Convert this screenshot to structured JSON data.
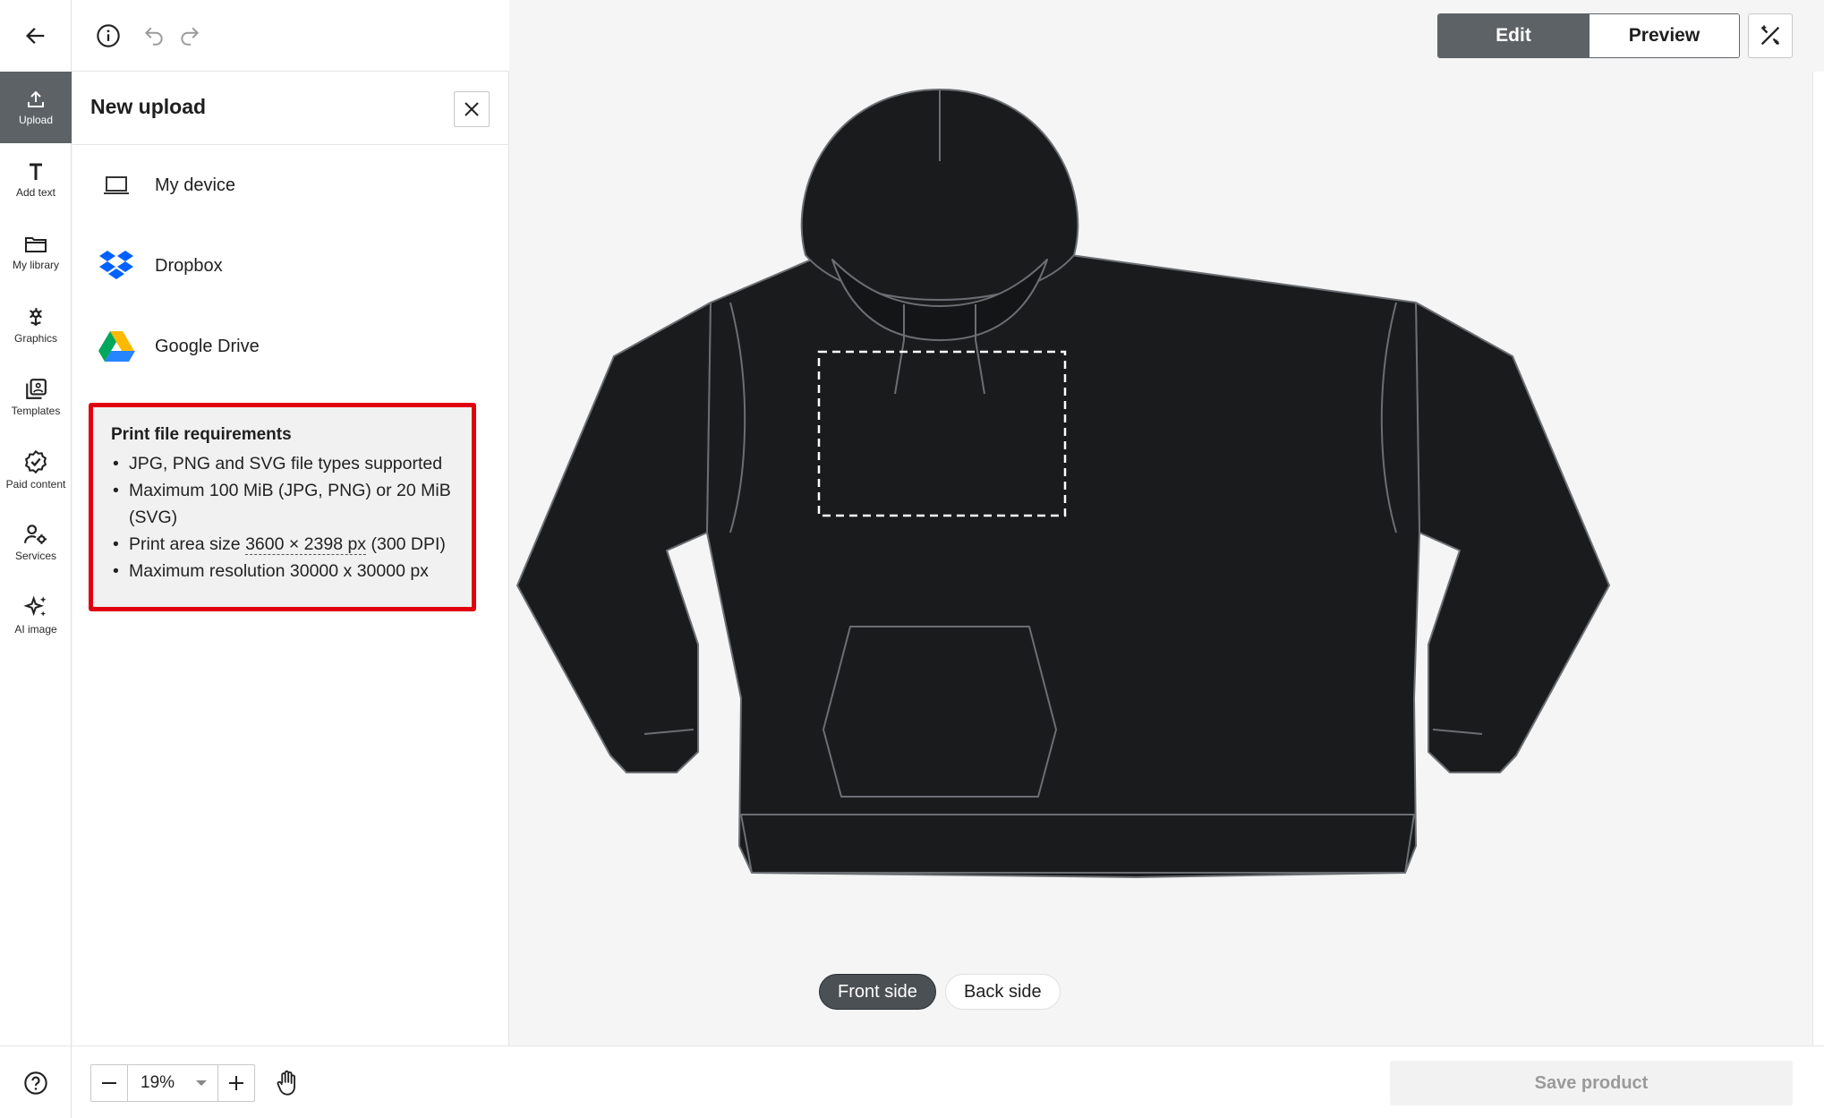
{
  "topbar": {
    "back_icon": "arrow-left-icon",
    "info_icon": "info-icon",
    "undo_icon": "undo-icon",
    "redo_icon": "redo-icon",
    "edit_label": "Edit",
    "preview_label": "Preview",
    "magic_icon": "magic-wand-icon"
  },
  "rail": {
    "items": [
      {
        "label": "Upload",
        "icon": "upload-icon",
        "active": true
      },
      {
        "label": "Add text",
        "icon": "text-icon"
      },
      {
        "label": "My library",
        "icon": "folder-icon"
      },
      {
        "label": "Graphics",
        "icon": "flower-icon"
      },
      {
        "label": "Templates",
        "icon": "template-icon"
      },
      {
        "label": "Paid content",
        "icon": "badge-check-icon"
      },
      {
        "label": "Services",
        "icon": "services-icon"
      },
      {
        "label": "AI image",
        "icon": "sparkle-icon"
      }
    ]
  },
  "panel": {
    "title": "New upload",
    "sources": [
      {
        "label": "My device",
        "icon": "laptop-icon"
      },
      {
        "label": "Dropbox",
        "icon": "dropbox-icon"
      },
      {
        "label": "Google Drive",
        "icon": "google-drive-icon"
      }
    ],
    "requirements": {
      "title": "Print file requirements",
      "item1": "JPG, PNG and SVG file types supported",
      "item2": "Maximum 100 MiB (JPG, PNG) or 20 MiB (SVG)",
      "item3_prefix": "Print area size ",
      "item3_size": "3600 × 2398 px",
      "item3_suffix": " (300 DPI)",
      "item4": "Maximum resolution 30000 x 30000 px"
    }
  },
  "canvas": {
    "front_label": "Front side",
    "back_label": "Back side",
    "garment_color": "#1a1b1d"
  },
  "bottombar": {
    "zoom_value": "19%",
    "save_label": "Save product"
  },
  "colors": {
    "accent_dark": "#5c6266",
    "highlight_red": "#e0000f"
  }
}
